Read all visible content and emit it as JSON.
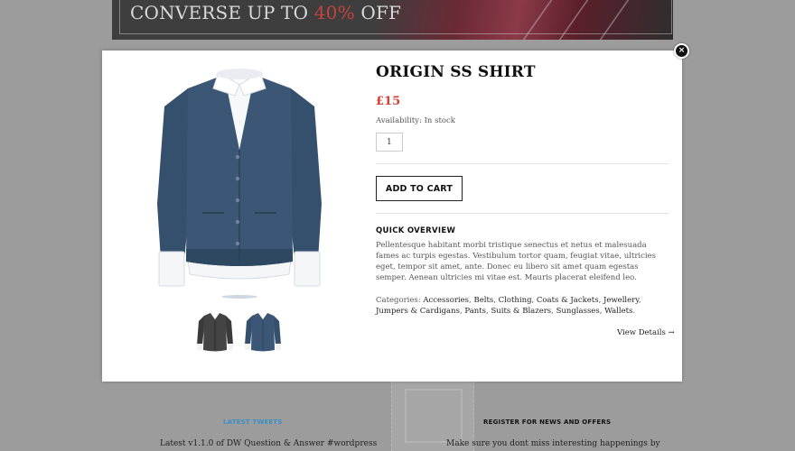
{
  "banner": {
    "text_before": "CONVERSE UP TO ",
    "text_accent": "40%",
    "text_after": " OFF"
  },
  "footer": {
    "tweets_heading": "LATEST TWEETS",
    "tweet_text": "Latest v1.1.0 of DW Question & Answer #wordpress",
    "register_heading": "REGISTER FOR NEWS AND OFFERS",
    "register_text": "Make sure you dont miss interesting happenings by"
  },
  "modal": {
    "close_glyph": "×",
    "product_name": "ORIGIN SS SHIRT",
    "price": "£15",
    "availability_label": "Availability:",
    "availability_value": "In stock",
    "quantity_value": "1",
    "add_to_cart_label": "ADD TO CART",
    "overview_heading": "QUICK OVERVIEW",
    "overview_text": "Pellentesque habitant morbi tristique senectus et netus et malesuada fames ac turpis egestas. Vestibulum tortor quam, feugiat vitae, ultricies eget, tempor sit amet, ante. Donec eu libero sit amet quam egestas semper. Aenean ultricies mi vitae est. Mauris placerat eleifend leo.",
    "categories_label": "Categories:",
    "categories": [
      "Accessories",
      "Belts",
      "Clothing",
      "Coats & Jackets",
      "Jewellery",
      "Jumpers & Cardigans",
      "Pants",
      "Suits & Blazers",
      "Sunglasses",
      "Wallets"
    ],
    "view_details_label": "View Details →",
    "images": [
      "black-cardigan-thumbnail",
      "navy-cardigan-thumbnail"
    ]
  },
  "colors": {
    "price_red": "#d83c32",
    "footer_accent_blue": "#3a8fc4",
    "overlay_grey": "#9c9c9c",
    "cardigan_navy": "#35506c",
    "cardigan_black": "#3a3a3a"
  }
}
